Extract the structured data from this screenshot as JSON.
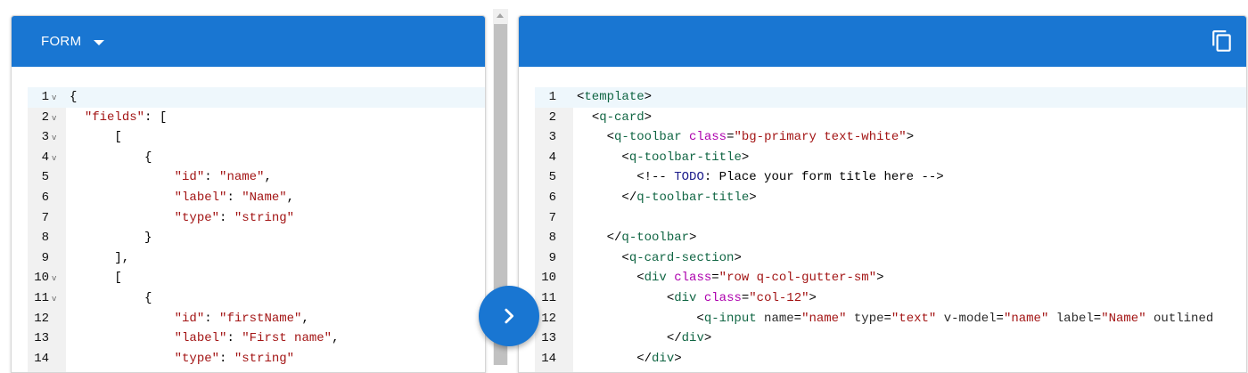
{
  "left_panel": {
    "dropdown_label": "FORM",
    "lines": [
      {
        "n": "1",
        "fold": "v",
        "tokens": [
          [
            "p",
            "{"
          ]
        ]
      },
      {
        "n": "2",
        "fold": "v",
        "tokens": [
          [
            "p",
            "  "
          ],
          [
            "k",
            "\"fields\""
          ],
          [
            "p",
            ": ["
          ]
        ]
      },
      {
        "n": "3",
        "fold": "v",
        "tokens": [
          [
            "p",
            "      ["
          ]
        ]
      },
      {
        "n": "4",
        "fold": "v",
        "tokens": [
          [
            "p",
            "          {"
          ]
        ]
      },
      {
        "n": "5",
        "fold": "",
        "tokens": [
          [
            "p",
            "              "
          ],
          [
            "k",
            "\"id\""
          ],
          [
            "p",
            ": "
          ],
          [
            "s",
            "\"name\""
          ],
          [
            "p",
            ","
          ]
        ]
      },
      {
        "n": "6",
        "fold": "",
        "tokens": [
          [
            "p",
            "              "
          ],
          [
            "k",
            "\"label\""
          ],
          [
            "p",
            ": "
          ],
          [
            "s",
            "\"Name\""
          ],
          [
            "p",
            ","
          ]
        ]
      },
      {
        "n": "7",
        "fold": "",
        "tokens": [
          [
            "p",
            "              "
          ],
          [
            "k",
            "\"type\""
          ],
          [
            "p",
            ": "
          ],
          [
            "s",
            "\"string\""
          ]
        ]
      },
      {
        "n": "8",
        "fold": "",
        "tokens": [
          [
            "p",
            "          }"
          ]
        ]
      },
      {
        "n": "9",
        "fold": "",
        "tokens": [
          [
            "p",
            "      ],"
          ]
        ]
      },
      {
        "n": "10",
        "fold": "v",
        "tokens": [
          [
            "p",
            "      ["
          ]
        ]
      },
      {
        "n": "11",
        "fold": "v",
        "tokens": [
          [
            "p",
            "          {"
          ]
        ]
      },
      {
        "n": "12",
        "fold": "",
        "tokens": [
          [
            "p",
            "              "
          ],
          [
            "k",
            "\"id\""
          ],
          [
            "p",
            ": "
          ],
          [
            "s",
            "\"firstName\""
          ],
          [
            "p",
            ","
          ]
        ]
      },
      {
        "n": "13",
        "fold": "",
        "tokens": [
          [
            "p",
            "              "
          ],
          [
            "k",
            "\"label\""
          ],
          [
            "p",
            ": "
          ],
          [
            "s",
            "\"First name\""
          ],
          [
            "p",
            ","
          ]
        ]
      },
      {
        "n": "14",
        "fold": "",
        "tokens": [
          [
            "p",
            "              "
          ],
          [
            "k",
            "\"type\""
          ],
          [
            "p",
            ": "
          ],
          [
            "s",
            "\"string\""
          ]
        ]
      }
    ]
  },
  "right_panel": {
    "copy_icon": "copy-icon",
    "lines": [
      {
        "n": "1",
        "tokens": [
          [
            "br",
            "<"
          ],
          [
            "tag",
            "template"
          ],
          [
            "br",
            ">"
          ]
        ]
      },
      {
        "n": "2",
        "tokens": [
          [
            "p",
            "  "
          ],
          [
            "br",
            "<"
          ],
          [
            "tag",
            "q-card"
          ],
          [
            "br",
            ">"
          ]
        ]
      },
      {
        "n": "3",
        "tokens": [
          [
            "p",
            "    "
          ],
          [
            "br",
            "<"
          ],
          [
            "tag",
            "q-toolbar"
          ],
          [
            "p",
            " "
          ],
          [
            "attr",
            "class"
          ],
          [
            "p",
            "="
          ],
          [
            "val",
            "\"bg-primary text-white\""
          ],
          [
            "br",
            ">"
          ]
        ]
      },
      {
        "n": "4",
        "tokens": [
          [
            "p",
            "      "
          ],
          [
            "br",
            "<"
          ],
          [
            "tag",
            "q-toolbar-title"
          ],
          [
            "br",
            ">"
          ]
        ]
      },
      {
        "n": "5",
        "tokens": [
          [
            "p",
            "        "
          ],
          [
            "cmt",
            "<!-- "
          ],
          [
            "todo",
            "TODO"
          ],
          [
            "cmt",
            ": Place your form title here -->"
          ]
        ]
      },
      {
        "n": "6",
        "tokens": [
          [
            "p",
            "      "
          ],
          [
            "br",
            "</"
          ],
          [
            "tag",
            "q-toolbar-title"
          ],
          [
            "br",
            ">"
          ]
        ]
      },
      {
        "n": "7",
        "tokens": [
          [
            "p",
            ""
          ]
        ]
      },
      {
        "n": "8",
        "tokens": [
          [
            "p",
            "    "
          ],
          [
            "br",
            "</"
          ],
          [
            "tag",
            "q-toolbar"
          ],
          [
            "br",
            ">"
          ]
        ]
      },
      {
        "n": "9",
        "tokens": [
          [
            "p",
            "      "
          ],
          [
            "br",
            "<"
          ],
          [
            "tag",
            "q-card-section"
          ],
          [
            "br",
            ">"
          ]
        ]
      },
      {
        "n": "10",
        "tokens": [
          [
            "p",
            "        "
          ],
          [
            "br",
            "<"
          ],
          [
            "tag",
            "div"
          ],
          [
            "p",
            " "
          ],
          [
            "attr",
            "class"
          ],
          [
            "p",
            "="
          ],
          [
            "val",
            "\"row q-col-gutter-sm\""
          ],
          [
            "br",
            ">"
          ]
        ]
      },
      {
        "n": "11",
        "tokens": [
          [
            "p",
            "            "
          ],
          [
            "br",
            "<"
          ],
          [
            "tag",
            "div"
          ],
          [
            "p",
            " "
          ],
          [
            "attr",
            "class"
          ],
          [
            "p",
            "="
          ],
          [
            "val",
            "\"col-12\""
          ],
          [
            "br",
            ">"
          ]
        ]
      },
      {
        "n": "12",
        "tokens": [
          [
            "p",
            "                "
          ],
          [
            "br",
            "<"
          ],
          [
            "tag",
            "q-input"
          ],
          [
            "p",
            " "
          ],
          [
            "attr2",
            "name"
          ],
          [
            "p",
            "="
          ],
          [
            "val",
            "\"name\""
          ],
          [
            "p",
            " "
          ],
          [
            "attr2",
            "type"
          ],
          [
            "p",
            "="
          ],
          [
            "val",
            "\"text\""
          ],
          [
            "p",
            " "
          ],
          [
            "attr2",
            "v-model"
          ],
          [
            "p",
            "="
          ],
          [
            "val",
            "\"name\""
          ],
          [
            "p",
            " "
          ],
          [
            "attr2",
            "label"
          ],
          [
            "p",
            "="
          ],
          [
            "val",
            "\"Name\""
          ],
          [
            "p",
            " "
          ],
          [
            "attr2",
            "outlined"
          ]
        ]
      },
      {
        "n": "13",
        "tokens": [
          [
            "p",
            "            "
          ],
          [
            "br",
            "</"
          ],
          [
            "tag",
            "div"
          ],
          [
            "br",
            ">"
          ]
        ]
      },
      {
        "n": "14",
        "tokens": [
          [
            "p",
            "        "
          ],
          [
            "br",
            "</"
          ],
          [
            "tag",
            "div"
          ],
          [
            "br",
            ">"
          ]
        ]
      }
    ]
  },
  "convert_button": {
    "icon": "chevron-right-icon"
  },
  "colors": {
    "primary": "#1976d2"
  }
}
